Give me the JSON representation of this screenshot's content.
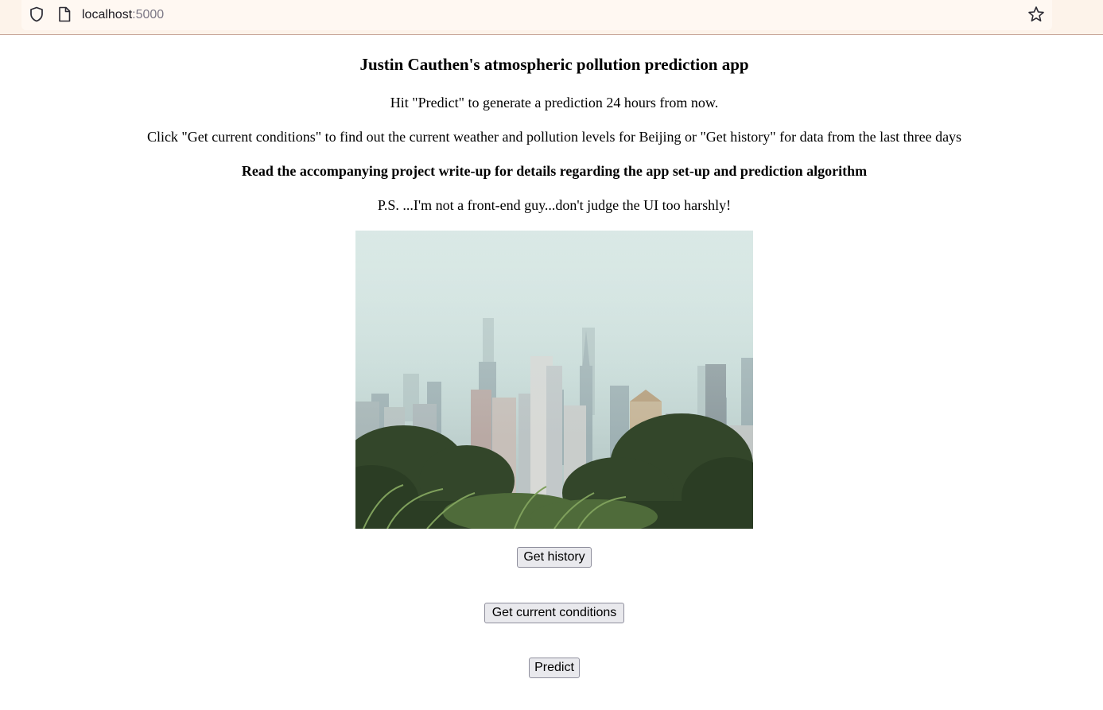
{
  "browser": {
    "url_host": "localhost",
    "url_port": ":5000",
    "icons": [
      "shield-icon",
      "page-icon",
      "bookmark-star-icon"
    ]
  },
  "page": {
    "title": "Justin Cauthen's atmospheric pollution prediction app",
    "paragraphs": [
      "Hit \"Predict\" to generate a prediction 24 hours from now.",
      "Click \"Get current conditions\" to find out the current weather and pollution levels for Beijing or \"Get history\" for data from the last three days",
      "Read the accompanying project write-up for details regarding the app set-up and prediction algorithm",
      "P.S. ...I'm not a front-end guy...don't judge the UI too harshly!"
    ],
    "buttons": {
      "history": "Get history",
      "current": "Get current conditions",
      "predict": "Predict"
    }
  },
  "colors": {
    "toolbar_bg": "#fdf3ea",
    "button_bg": "#e9e9ed",
    "button_border": "#8f8f9d"
  }
}
